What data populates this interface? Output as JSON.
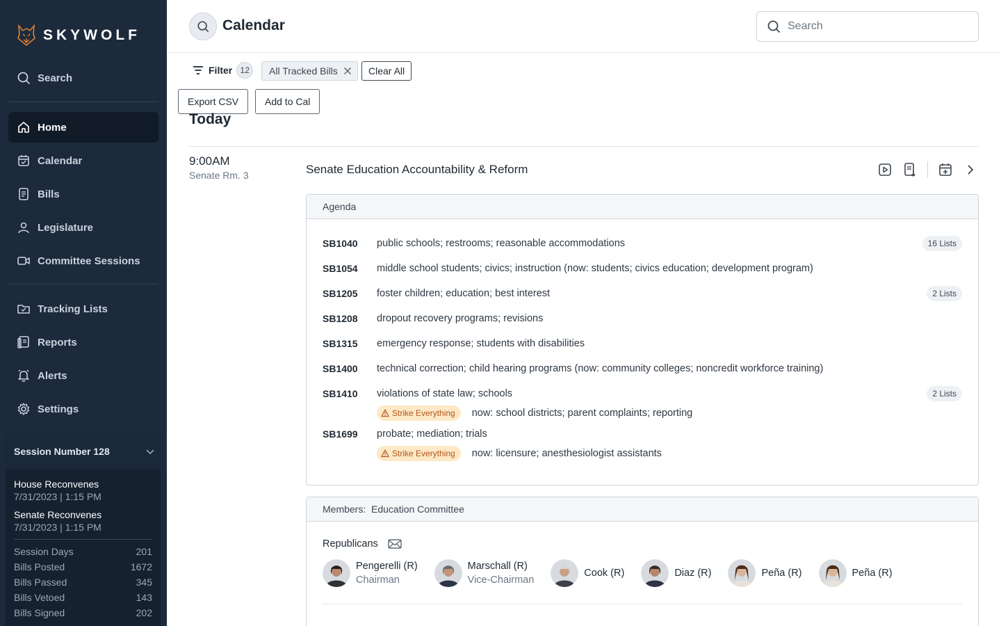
{
  "app": {
    "brand": "SKYWOLF",
    "page_title": "Calendar"
  },
  "sidebar": {
    "search_label": "Search",
    "primary": [
      {
        "label": "Home",
        "icon": "home-icon",
        "active": true
      },
      {
        "label": "Calendar",
        "icon": "calendar-icon",
        "active": false
      },
      {
        "label": "Bills",
        "icon": "bills-icon",
        "active": false
      },
      {
        "label": "Legislature",
        "icon": "person-icon",
        "active": false
      },
      {
        "label": "Committee Sessions",
        "icon": "video-icon",
        "active": false
      }
    ],
    "secondary": [
      {
        "label": "Tracking Lists",
        "icon": "folder-check-icon"
      },
      {
        "label": "Reports",
        "icon": "reports-icon"
      },
      {
        "label": "Alerts",
        "icon": "bell-icon"
      },
      {
        "label": "Settings",
        "icon": "gear-icon"
      }
    ],
    "session": {
      "title": "Session Number 128",
      "events": [
        {
          "title": "House Reconvenes",
          "date": "7/31/2023 | 1:15 PM"
        },
        {
          "title": "Senate Reconvenes",
          "date": "7/31/2023 | 1:15 PM"
        }
      ],
      "stats": [
        {
          "label": "Session Days",
          "value": "201"
        },
        {
          "label": "Bills Posted",
          "value": "1672"
        },
        {
          "label": "Bills Passed",
          "value": "345"
        },
        {
          "label": "Bills Vetoed",
          "value": "143"
        },
        {
          "label": "Bills Signed",
          "value": "202"
        }
      ]
    }
  },
  "header": {
    "search_placeholder": "Search"
  },
  "toolbar": {
    "filter_label": "Filter",
    "filter_count": "12",
    "chip_label": "All Tracked Bills",
    "clear_label": "Clear All",
    "export_label": "Export CSV",
    "add_cal_label": "Add to Cal"
  },
  "day_label": "Today",
  "event": {
    "time": "9:00AM",
    "room": "Senate Rm. 3",
    "name": "Senate Education Accountability & Reform",
    "agenda_title": "Agenda",
    "agenda": [
      {
        "bill": "SB1040",
        "desc": "public schools; restrooms; reasonable accommodations",
        "lists": "16 Lists"
      },
      {
        "bill": "SB1054",
        "desc": "middle school students; civics; instruction (now: students; civics education; development program)",
        "lists": ""
      },
      {
        "bill": "SB1205",
        "desc": "foster children; education; best interest",
        "lists": "2 Lists"
      },
      {
        "bill": "SB1208",
        "desc": "dropout recovery programs; revisions",
        "lists": ""
      },
      {
        "bill": "SB1315",
        "desc": "emergency response; students with disabilities",
        "lists": ""
      },
      {
        "bill": "SB1400",
        "desc": "technical correction; child hearing programs (now: community colleges; noncredit workforce training)",
        "lists": ""
      },
      {
        "bill": "SB1410",
        "desc": "violations of state law; schools",
        "lists": "2 Lists",
        "strike": "Strike Everything",
        "now": "now: school districts; parent complaints; reporting"
      },
      {
        "bill": "SB1699",
        "desc": "probate; mediation; trials",
        "lists": "",
        "strike": "Strike Everything",
        "now": "now: licensure; anesthesiologist assistants"
      }
    ],
    "members_label": "Members:",
    "committee_name": "Education Committee",
    "party_label": "Republicans",
    "members": [
      {
        "name": "Pengerelli (R)",
        "role": "Chairman",
        "skin": "#b98a6f",
        "hair": "#2b1d15",
        "cloth": "#2d3138"
      },
      {
        "name": "Marschall (R)",
        "role": "Vice-Chairman",
        "skin": "#c29678",
        "hair": "#6b6b6b",
        "cloth": "#2a3442"
      },
      {
        "name": "Cook (R)",
        "role": "",
        "skin": "#c8a084",
        "hair": "#d8d8d8",
        "cloth": "#3a3f48"
      },
      {
        "name": "Diaz (R)",
        "role": "",
        "skin": "#b5876a",
        "hair": "#3a2a20",
        "cloth": "#2c3440"
      },
      {
        "name": "Peña (R)",
        "role": "",
        "skin": "#d9b49a",
        "hair": "#4a2c1c",
        "cloth": "#e8e2da"
      },
      {
        "name": "Peña (R)",
        "role": "",
        "skin": "#d9b49a",
        "hair": "#4a2c1c",
        "cloth": "#e8e2da"
      }
    ]
  }
}
